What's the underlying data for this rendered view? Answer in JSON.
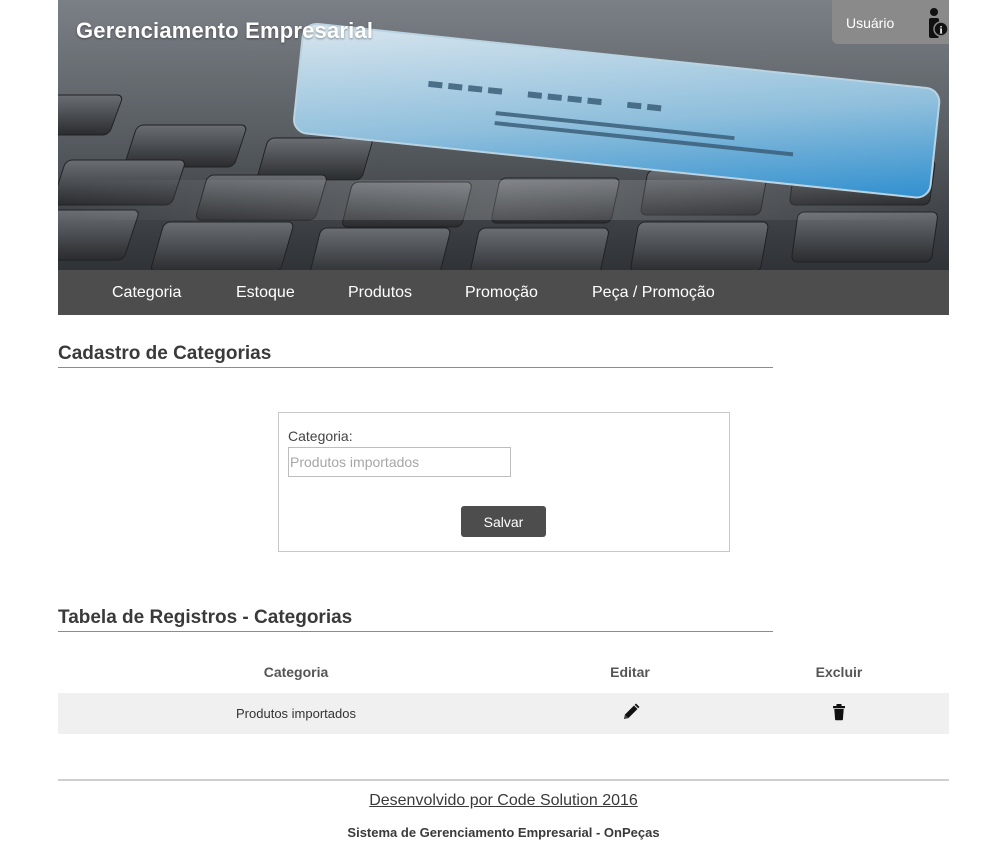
{
  "header": {
    "title": "Gerenciamento Empresarial",
    "user_label": "Usuário",
    "user_icon": "user-info-icon"
  },
  "nav": {
    "items": [
      {
        "label": "Categoria"
      },
      {
        "label": "Estoque"
      },
      {
        "label": "Produtos"
      },
      {
        "label": "Promoção"
      },
      {
        "label": "Peça / Promoção"
      }
    ]
  },
  "form_section": {
    "title": "Cadastro de Categorias",
    "field_label": "Categoria:",
    "field_value": "",
    "field_placeholder": "Produtos importados",
    "save_label": "Salvar"
  },
  "table_section": {
    "title": "Tabela de Registros - Categorias",
    "columns": [
      "Categoria",
      "Editar",
      "Excluir"
    ],
    "rows": [
      {
        "categoria": "Produtos importados",
        "edit_icon": "pencil-icon",
        "delete_icon": "trash-icon"
      }
    ]
  },
  "footer": {
    "developer": "Desenvolvido por Code Solution 2016",
    "system": "Sistema de Gerenciamento Empresarial - OnPeças"
  },
  "colors": {
    "nav_bg": "#4d4d4d",
    "button_bg": "#4d4d4d",
    "row_bg": "#f0f0f0",
    "user_box_bg": "#8a8a8a"
  }
}
